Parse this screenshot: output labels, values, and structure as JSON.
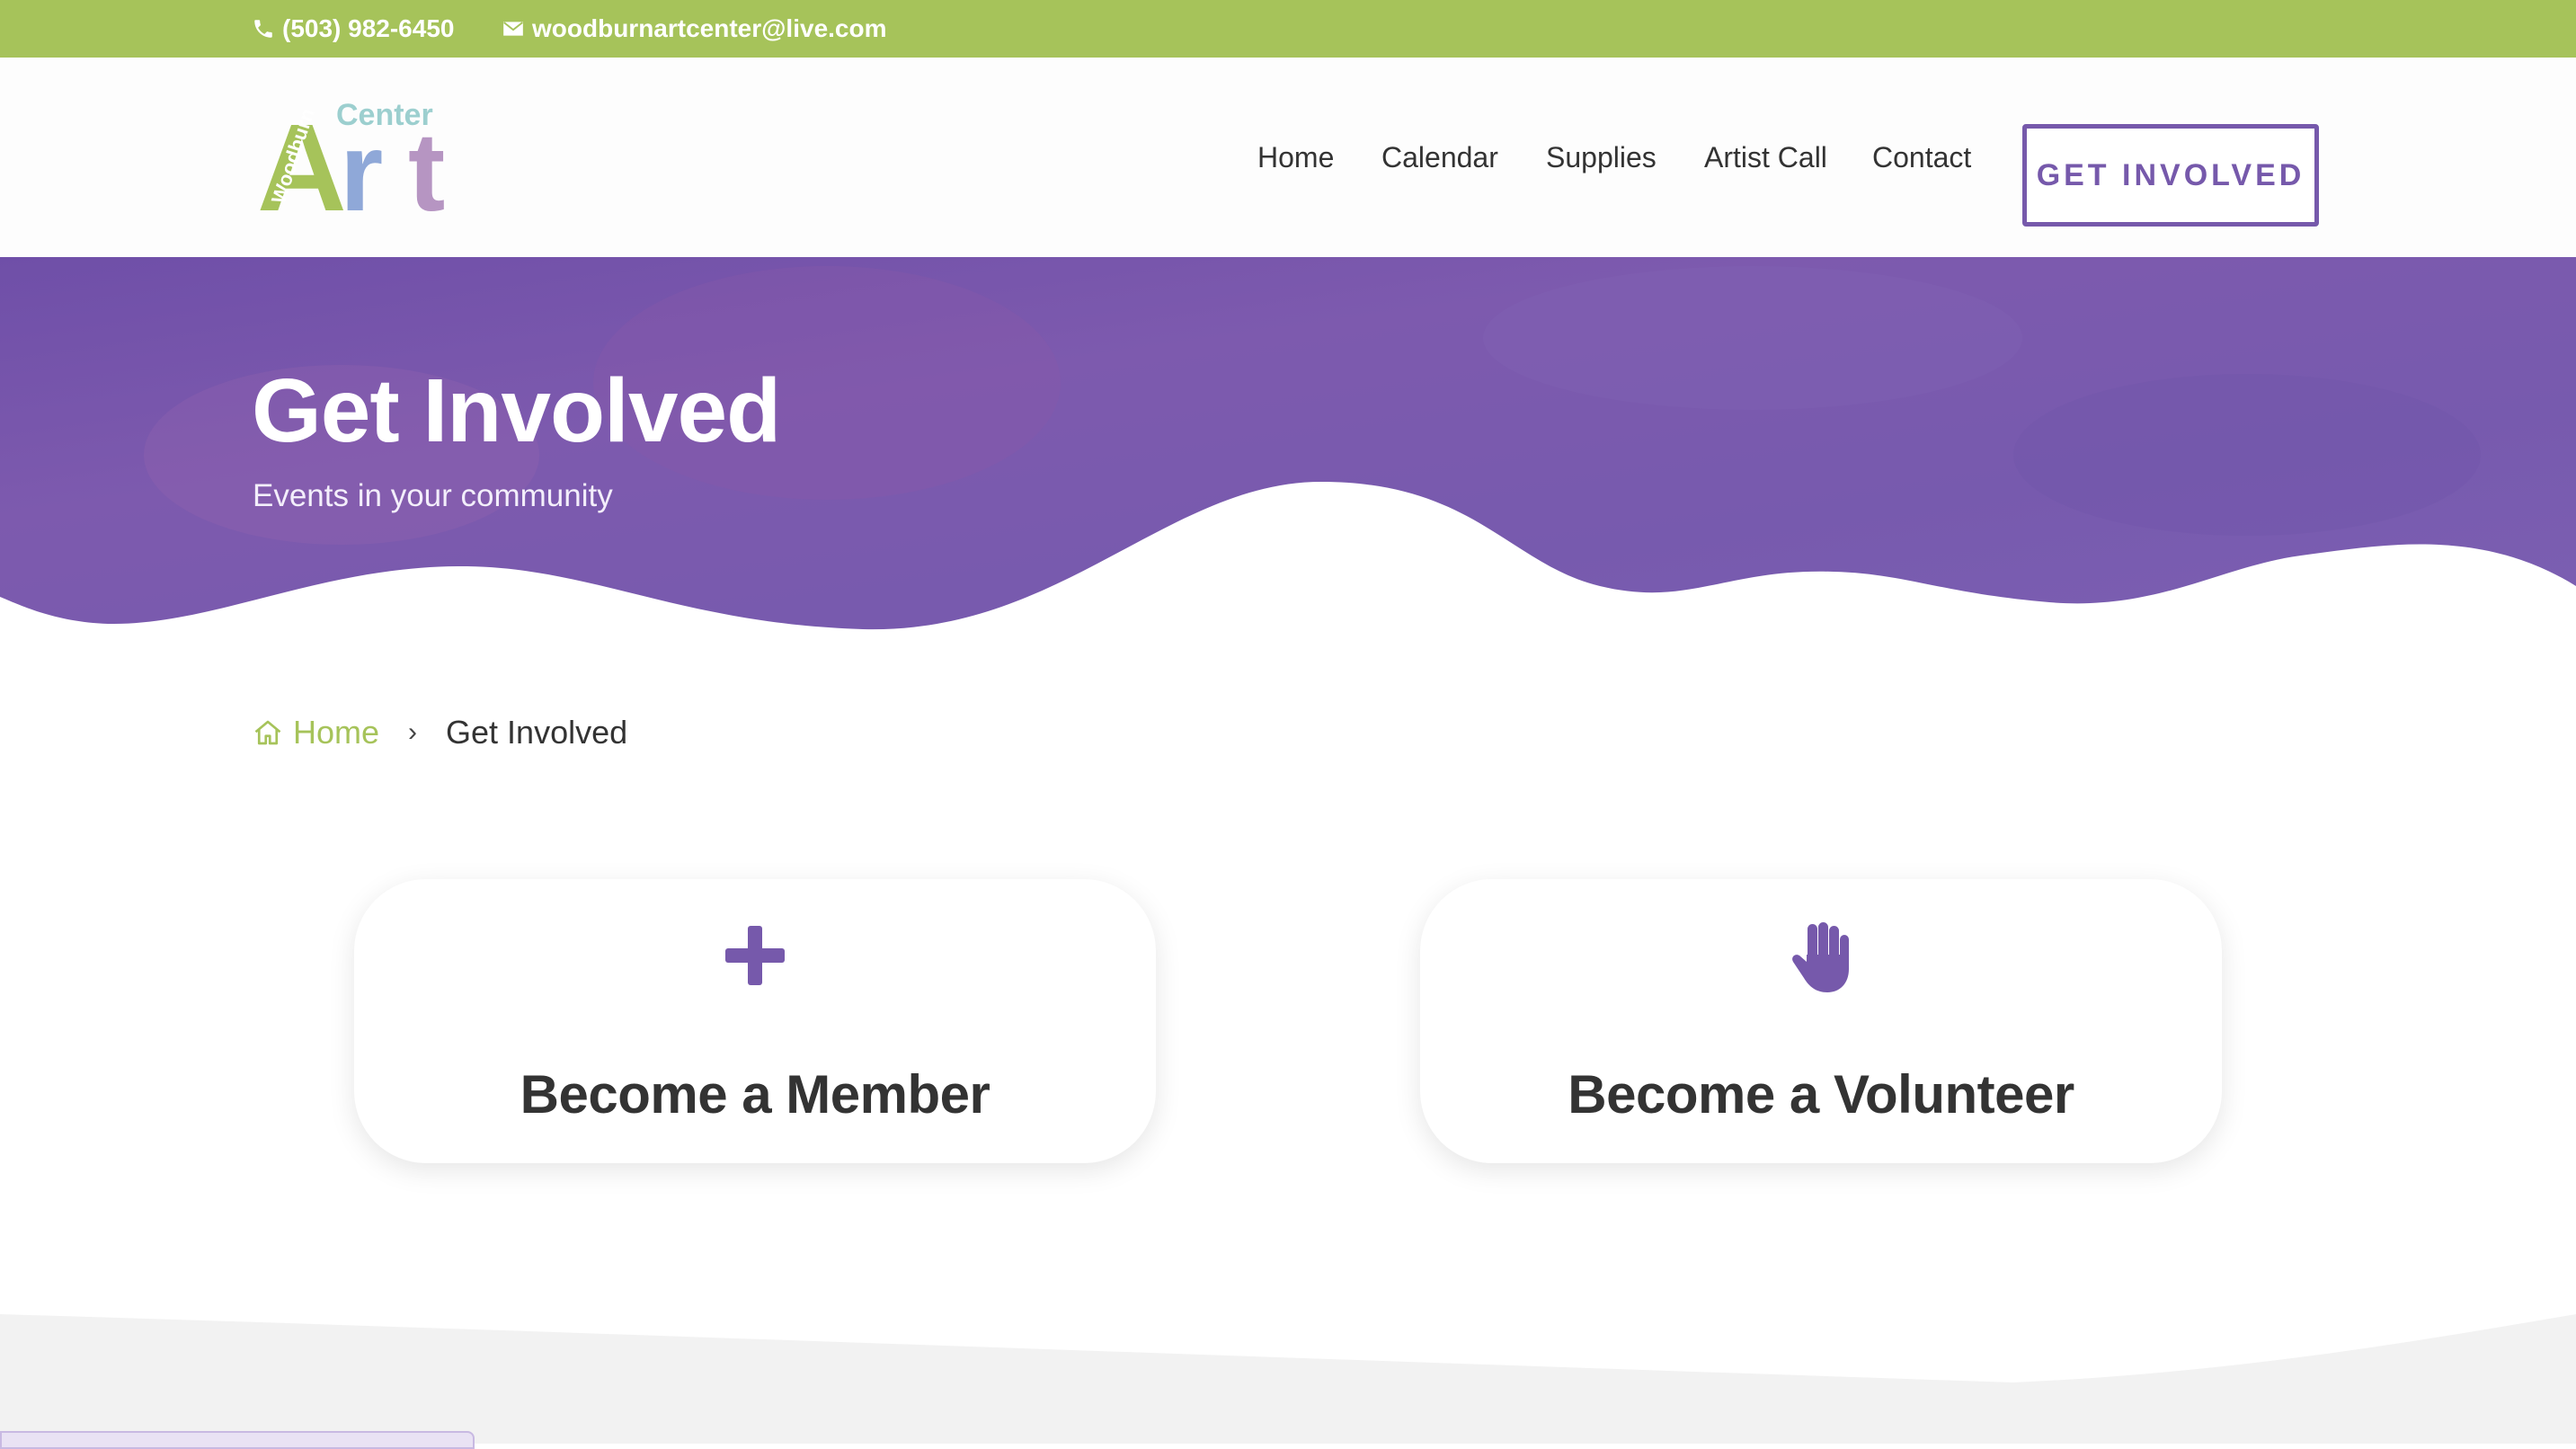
{
  "topbar": {
    "phone": "(503) 982-6450",
    "email": "woodburnartcenter@live.com",
    "phone_icon": "phone-icon",
    "email_icon": "envelope-icon",
    "background": "#a6c35a"
  },
  "logo": {
    "small_word": "Woodburn",
    "top_word": "Center",
    "main_word": "Art",
    "colors": [
      "#a6c35a",
      "#8fa8d8",
      "#b695c2",
      "#9ccfcf"
    ]
  },
  "nav": {
    "items": [
      {
        "label": "Home"
      },
      {
        "label": "Calendar"
      },
      {
        "label": "Supplies"
      },
      {
        "label": "Artist Call"
      },
      {
        "label": "Contact"
      }
    ],
    "cta_label": "GET INVOLVED"
  },
  "hero": {
    "title": "Get Involved",
    "subtitle": "Events in your community",
    "background": "#7659ab"
  },
  "breadcrumb": {
    "home_icon": "home-icon",
    "home_label": "Home",
    "separator": "›",
    "current": "Get Involved"
  },
  "cards": [
    {
      "icon": "plus-icon",
      "title": "Become a Member"
    },
    {
      "icon": "raised-hand-icon",
      "title": "Become a Volunteer"
    }
  ],
  "colors": {
    "accent_green": "#a6c35a",
    "accent_purple": "#7659ab",
    "text_dark": "#333333",
    "footer_gray": "#f2f2f2"
  }
}
